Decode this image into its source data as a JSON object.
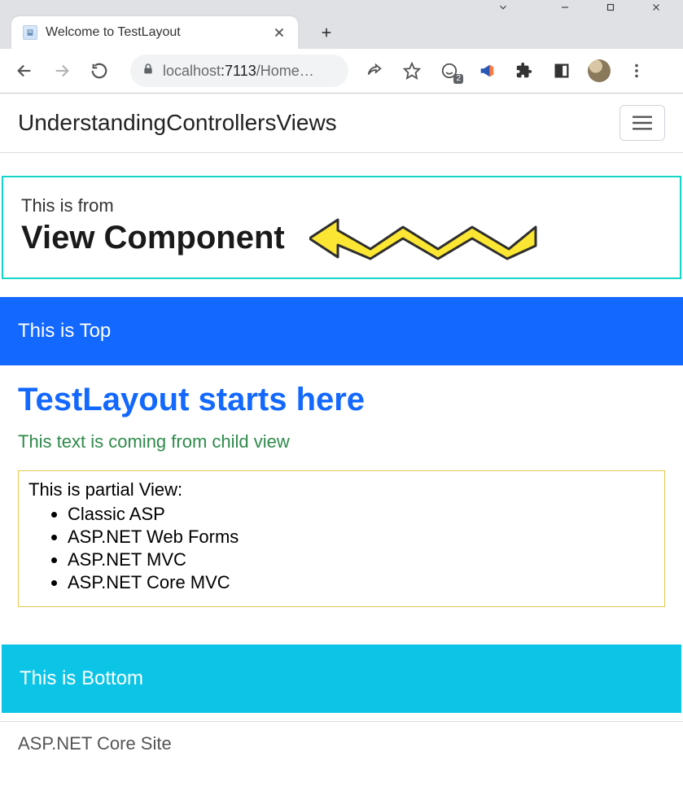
{
  "browser": {
    "tab_title": "Welcome to TestLayout",
    "url_host_dim": "localhost",
    "url_port": ":7113",
    "url_path": "/Home…",
    "extension_badge": "2"
  },
  "navbar": {
    "brand": "UnderstandingControllersViews"
  },
  "view_component": {
    "subtitle": "This is from",
    "title": "View Component"
  },
  "sections": {
    "top": "This is Top",
    "bottom": "This is Bottom"
  },
  "main": {
    "heading": "TestLayout starts here",
    "child_text": "This text is coming from child view"
  },
  "partial": {
    "label": "This is partial View:",
    "items": [
      "Classic ASP",
      "ASP.NET Web Forms",
      "ASP.NET MVC",
      "ASP.NET Core MVC"
    ]
  },
  "footer": {
    "text": "ASP.NET Core Site"
  }
}
